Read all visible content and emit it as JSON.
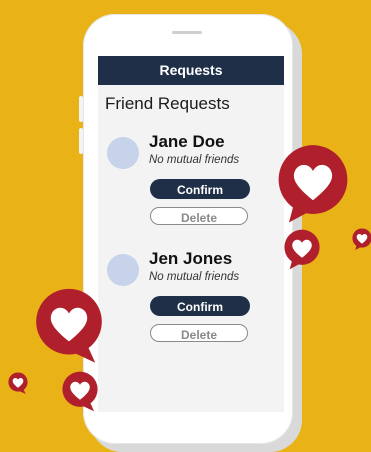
{
  "header": {
    "title": "Requests"
  },
  "section": {
    "title": "Friend Requests"
  },
  "requests": [
    {
      "name": "Jane Doe",
      "mutual": "No mutual friends",
      "confirm_label": "Confirm",
      "delete_label": "Delete"
    },
    {
      "name": "Jen Jones",
      "mutual": "No mutual friends",
      "confirm_label": "Confirm",
      "delete_label": "Delete"
    }
  ],
  "colors": {
    "background": "#E9B217",
    "primary": "#1F2F48",
    "heart_bubble": "#B0202C",
    "avatar": "#C6D3EA"
  },
  "icons": [
    "heart-bubble-icon"
  ]
}
